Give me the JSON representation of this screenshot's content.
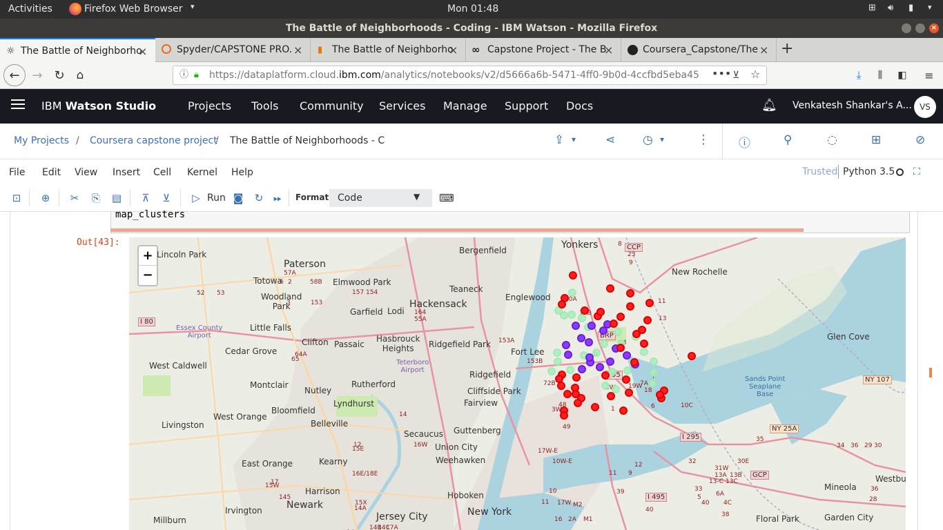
{
  "system": {
    "activities": "Activities",
    "app_name": "Firefox Web Browser",
    "clock": "Mon 01:48"
  },
  "window": {
    "title": "The Battle of Neighborhoods - Coding - IBM Watson - Mozilla Firefox"
  },
  "tabs": [
    {
      "label": "The Battle of Neighborho"
    },
    {
      "label": "Spyder/CAPSTONE PRO."
    },
    {
      "label": "The Battle of Neighborho"
    },
    {
      "label": "Capstone Project - The B"
    },
    {
      "label": "Coursera_Capstone/The"
    }
  ],
  "url": {
    "prefix": "https://dataplatform.cloud.",
    "domain": "ibm.com",
    "path": "/analytics/notebooks/v2/d5666a6b-5471-4ff0-9b0d-4ccfbd5eba45"
  },
  "watson": {
    "brand_prefix": "IBM ",
    "brand_bold": "Watson Studio",
    "nav": [
      "Projects",
      "Tools",
      "Community",
      "Services",
      "Manage",
      "Support",
      "Docs"
    ],
    "user_name": "Venkatesh Shankar's A...",
    "avatar": "VS"
  },
  "breadcrumb": {
    "root": "My Projects",
    "sep": "/",
    "project": "Coursera capstone project",
    "notebook": "The Battle of Neighborhoods - Codi"
  },
  "menu": {
    "items": [
      "File",
      "Edit",
      "View",
      "Insert",
      "Cell",
      "Kernel",
      "Help"
    ],
    "trusted": "Trusted",
    "kernel": "Python 3.5"
  },
  "toolbar": {
    "run": "Run",
    "format_label": "Format",
    "cell_type": "Code"
  },
  "cell": {
    "code": "map_clusters",
    "out_prompt": "Out[43]:"
  },
  "map": {
    "zoom_in": "+",
    "zoom_out": "−",
    "labels": {
      "yonkers": "Yonkers",
      "paterson": "Paterson",
      "bergenfield": "Bergenfield",
      "new_rochelle": "New Rochelle",
      "lincoln_park": "Lincoln Park",
      "totowa": "Totowa",
      "elmwood_park": "Elmwood Park",
      "teaneck": "Teaneck",
      "englewood": "Englewood",
      "hackensack": "Hackensack",
      "woodland_park": "Woodland\nPark",
      "garfield": "Garfield",
      "lodi": "Lodi",
      "little_falls": "Little Falls",
      "essex_airport": "Essex County\nAirport",
      "hasbrouck": "Hasbrouck\nHeights",
      "ridgefield_park": "Ridgefield Park",
      "fort_lee": "Fort Lee",
      "clifton": "Clifton",
      "passaic": "Passaic",
      "cedar_grove": "Cedar Grove",
      "west_caldwell": "West Caldwell",
      "teterboro": "Teterboro\nAirport",
      "ridgefield": "Ridgefield",
      "montclair": "Montclair",
      "rutherford": "Rutherford",
      "nutley": "Nutley",
      "cliffside_park": "Cliffside Park",
      "lyndhurst": "Lyndhurst",
      "fairview": "Fairview",
      "west_orange": "West Orange",
      "bloomfield": "Bloomfield",
      "livingston": "Livingston",
      "belleville": "Belleville",
      "secaucus": "Secaucus",
      "guttenberg": "Guttenberg",
      "union_city": "Union City",
      "weehawken": "Weehawken",
      "east_orange": "East Orange",
      "kearny": "Kearny",
      "harrison": "Harrison",
      "hoboken": "Hoboken",
      "newark": "Newark",
      "irvington": "Irvington",
      "jersey_city": "Jersey City",
      "new_york": "New York",
      "millburn": "Millburn",
      "glen_cove": "Glen Cove",
      "sands_point": "Sands Point\nSeaplane\nBase",
      "mineola": "Mineola",
      "westbury": "Westbury",
      "garden_city": "Garden City",
      "floral_park": "Floral Park",
      "ccp": "CCP",
      "brp": "BRP",
      "gcp": "GCP",
      "i80": "I 80",
      "i95": "I 95",
      "i295": "I 295",
      "i495": "I 495",
      "ny107": "NY 107",
      "ny25a": "NY 25A"
    },
    "route_numbers": [
      "57A",
      "6",
      "58B",
      "2",
      "52",
      "53",
      "157",
      "154",
      "153",
      "3",
      "164",
      "55A",
      "64A",
      "65",
      "153A",
      "153B",
      "72B",
      "14",
      "12",
      "16W",
      "15E",
      "16E/18E",
      "17",
      "15W",
      "145",
      "15X",
      "14A",
      "14B",
      "14C",
      "14",
      "17A",
      "17W",
      "10",
      "8",
      "23",
      "9",
      "10A",
      "10B",
      "11",
      "13",
      "5",
      "4",
      "7",
      "7A",
      "19W",
      "2W",
      "18",
      "48",
      "49",
      "3W",
      "6",
      "10C",
      "1",
      "9",
      "11",
      "12",
      "13A",
      "13B",
      "13-C",
      "13C",
      "35",
      "34",
      "36",
      "29",
      "30",
      "31W",
      "32",
      "30E",
      "33",
      "5",
      "6A",
      "4C",
      "40",
      "38",
      "40",
      "36",
      "28",
      "39",
      "11",
      "16",
      "2A",
      "M1",
      "M2",
      "10W-E",
      "17W-E",
      "15E",
      "16E",
      "17E",
      "45",
      "45"
    ],
    "clusters": {
      "red": 39,
      "purple": 16,
      "green": 24
    }
  }
}
